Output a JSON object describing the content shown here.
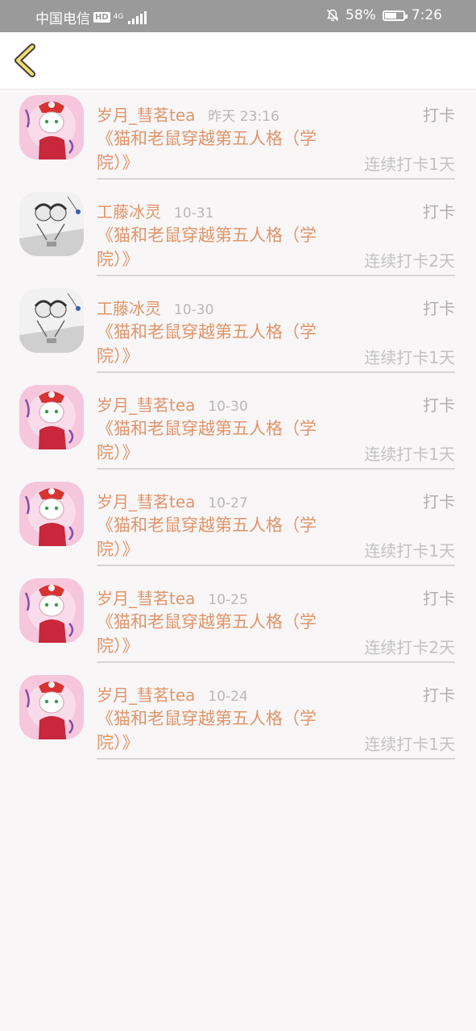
{
  "status_bar": {
    "carrier": "中国电信",
    "hd": "HD",
    "network": "4G",
    "battery": "58%",
    "time": "7:26"
  },
  "header": {
    "back_icon": "chevron-left-icon"
  },
  "records": [
    {
      "name": "岁月_彗茗tea",
      "time": "昨天 23:16",
      "action": "打卡",
      "title": "《猫和老鼠穿越第五人格（学院）》",
      "streak": "连续打卡1天",
      "avatar": "pink"
    },
    {
      "name": "工藤冰灵",
      "time": "10-31",
      "action": "打卡",
      "title": "《猫和老鼠穿越第五人格（学院）》",
      "streak": "连续打卡2天",
      "avatar": "sketch"
    },
    {
      "name": "工藤冰灵",
      "time": "10-30",
      "action": "打卡",
      "title": "《猫和老鼠穿越第五人格（学院）》",
      "streak": "连续打卡1天",
      "avatar": "sketch"
    },
    {
      "name": "岁月_彗茗tea",
      "time": "10-30",
      "action": "打卡",
      "title": "《猫和老鼠穿越第五人格（学院）》",
      "streak": "连续打卡1天",
      "avatar": "pink"
    },
    {
      "name": "岁月_彗茗tea",
      "time": "10-27",
      "action": "打卡",
      "title": "《猫和老鼠穿越第五人格（学院）》",
      "streak": "连续打卡1天",
      "avatar": "pink"
    },
    {
      "name": "岁月_彗茗tea",
      "time": "10-25",
      "action": "打卡",
      "title": "《猫和老鼠穿越第五人格（学院）》",
      "streak": "连续打卡2天",
      "avatar": "pink"
    },
    {
      "name": "岁月_彗茗tea",
      "time": "10-24",
      "action": "打卡",
      "title": "《猫和老鼠穿越第五人格（学院）》",
      "streak": "连续打卡1天",
      "avatar": "pink"
    }
  ],
  "colors": {
    "accent": "#e0956a",
    "status_bar": "#9a9a9a",
    "muted_text": "#b0b0b0"
  }
}
